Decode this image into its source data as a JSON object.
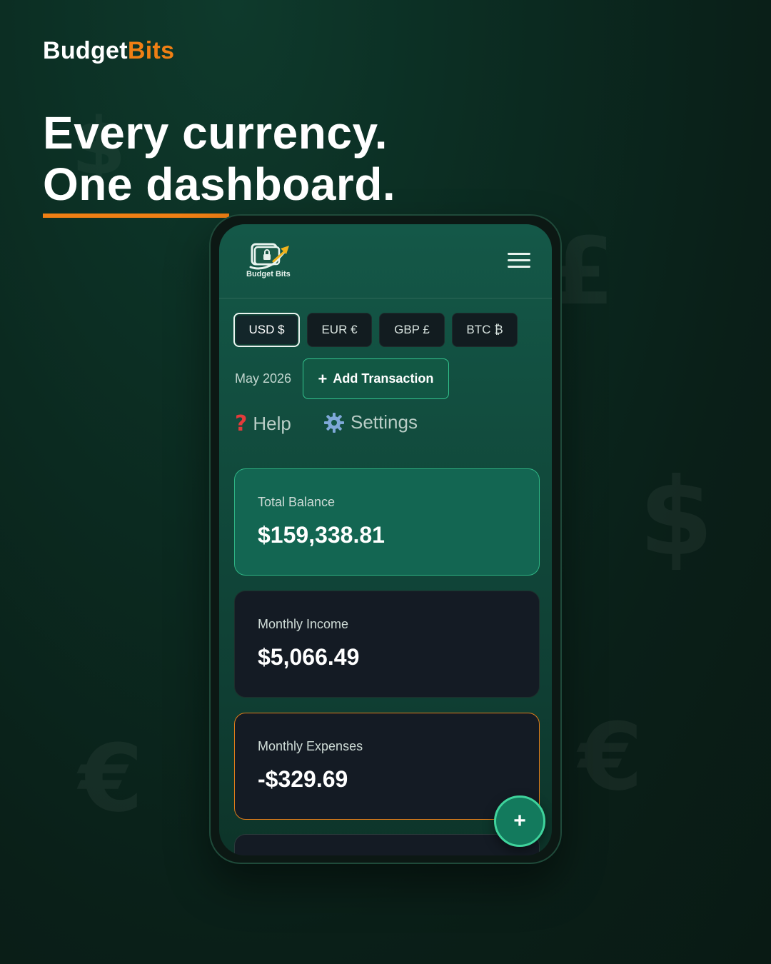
{
  "brand": {
    "part1": "Budget",
    "part2": "Bits"
  },
  "headline": {
    "line1": "Every currency.",
    "line2": "One dashboard."
  },
  "colors": {
    "accent": "#f07f14",
    "green": "#34c48e",
    "background": "#0b2a20"
  },
  "background_symbols": [
    "$",
    "£",
    "$",
    "€",
    "€"
  ],
  "app": {
    "logo_text": "Budget Bits",
    "menu_icon": "hamburger-menu-icon",
    "currencies": [
      {
        "label": "USD $",
        "active": true
      },
      {
        "label": "EUR €",
        "active": false
      },
      {
        "label": "GBP £",
        "active": false
      },
      {
        "label": "BTC ₿",
        "active": false
      }
    ],
    "month": "May 2026",
    "add_transaction_label": "Add Transaction",
    "add_transaction_icon": "plus-icon",
    "help_label": "Help",
    "help_icon": "question-mark-icon",
    "settings_label": "Settings",
    "settings_icon": "gear-icon",
    "cards": [
      {
        "label": "Total Balance",
        "value": "$159,338.81"
      },
      {
        "label": "Monthly Income",
        "value": "$5,066.49"
      },
      {
        "label": "Monthly Expenses",
        "value": "-$329.69"
      }
    ],
    "fab_symbol": "+"
  }
}
